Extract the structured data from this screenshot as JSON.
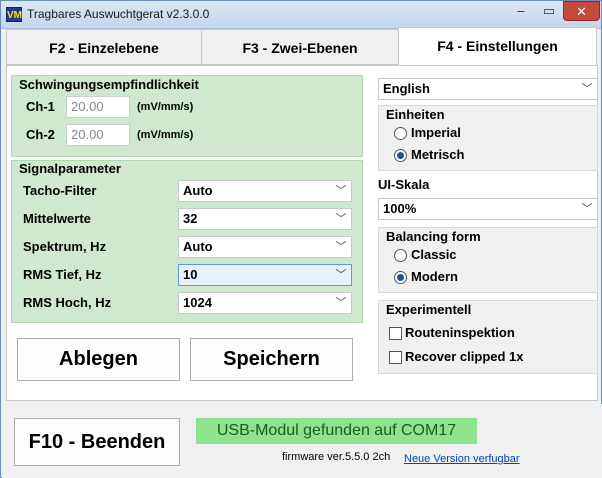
{
  "window": {
    "title": "Tragbares Auswuchtgerat v2.3.0.0",
    "app_icon_text": "VM",
    "minimize": "–",
    "maximize": "▭",
    "close": "✕"
  },
  "tabs": [
    {
      "label": "F2 - Einzelebene"
    },
    {
      "label": "F3 - Zwei-Ebenen"
    },
    {
      "label": "F4 - Einstellungen"
    }
  ],
  "sensitivity": {
    "title": "Schwingungsempfindlichkeit",
    "channels": [
      {
        "label": "Ch-1",
        "value": "20.00",
        "unit": "(mV/mm/s)"
      },
      {
        "label": "Ch-2",
        "value": "20.00",
        "unit": "(mV/mm/s)"
      }
    ]
  },
  "signal": {
    "title": "Signalparameter",
    "rows": [
      {
        "label": "Tacho-Filter",
        "value": "Auto"
      },
      {
        "label": "Mittelwerte",
        "value": "32"
      },
      {
        "label": "Spektrum, Hz",
        "value": "Auto"
      },
      {
        "label": "RMS Tief, Hz",
        "value": "10"
      },
      {
        "label": "RMS Hoch, Hz",
        "value": "1024"
      }
    ]
  },
  "buttons": {
    "discard": "Ablegen",
    "save": "Speichern",
    "exit": "F10 - Beenden"
  },
  "settings": {
    "language": "English",
    "units": {
      "title": "Einheiten",
      "options": [
        "Imperial",
        "Metrisch"
      ],
      "selected": "Metrisch"
    },
    "ui_scale": {
      "title": "UI-Skala",
      "value": "100%"
    },
    "balancing_form": {
      "title": "Balancing form",
      "options": [
        "Classic",
        "Modern"
      ],
      "selected": "Modern"
    },
    "experimental": {
      "title": "Experimentell",
      "options": [
        {
          "label": "Routeninspektion",
          "checked": false
        },
        {
          "label": "Recover clipped 1x",
          "checked": false
        }
      ]
    }
  },
  "status": {
    "usb": "USB-Modul gefunden auf COM17",
    "firmware": "firmware ver.5.5.0 2ch",
    "update_link": "Neue Version verfugbar"
  },
  "colors": {
    "group_green": "#cfe8cf",
    "usb_green": "#8fe38f",
    "link": "#0645ad"
  }
}
